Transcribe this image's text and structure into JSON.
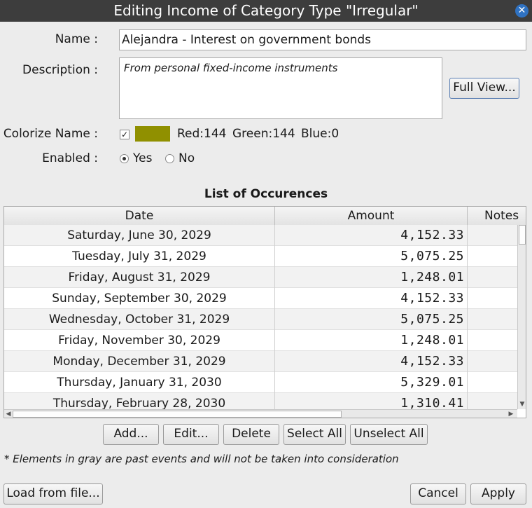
{
  "window": {
    "title": "Editing Income of Category Type \"Irregular\"",
    "close_icon": "close-icon"
  },
  "form": {
    "name_label": "Name :",
    "name_value": "Alejandra - Interest on government bonds",
    "description_label": "Description :",
    "description_value": "From personal fixed-income instruments",
    "full_view_label": "Full View...",
    "colorize_label": "Colorize Name :",
    "colorize_checked": true,
    "color_swatch": "#909000",
    "color_text": {
      "red": "Red:144",
      "green": "Green:144",
      "blue": "Blue:0"
    },
    "enabled_label": "Enabled :",
    "enabled_yes": "Yes",
    "enabled_no": "No",
    "enabled_value": "Yes"
  },
  "occurrences": {
    "title": "List of Occurences",
    "columns": [
      "Date",
      "Amount",
      "Notes"
    ],
    "rows": [
      {
        "date": "Saturday, June 30, 2029",
        "amount": "4,152.33"
      },
      {
        "date": "Tuesday, July 31, 2029",
        "amount": "5,075.25"
      },
      {
        "date": "Friday, August 31, 2029",
        "amount": "1,248.01"
      },
      {
        "date": "Sunday, September 30, 2029",
        "amount": "4,152.33"
      },
      {
        "date": "Wednesday, October 31, 2029",
        "amount": "5,075.25"
      },
      {
        "date": "Friday, November 30, 2029",
        "amount": "1,248.01"
      },
      {
        "date": "Monday, December 31, 2029",
        "amount": "4,152.33"
      },
      {
        "date": "Thursday, January 31, 2030",
        "amount": "5,329.01"
      },
      {
        "date": "Thursday, February 28, 2030",
        "amount": "1,310.41"
      }
    ]
  },
  "actions": {
    "add": "Add...",
    "edit": "Edit...",
    "delete": "Delete",
    "select_all": "Select All",
    "unselect_all": "Unselect All"
  },
  "footnote": "* Elements in gray are past events and will not be taken into consideration",
  "footer": {
    "load": "Load from file...",
    "cancel": "Cancel",
    "apply": "Apply"
  }
}
